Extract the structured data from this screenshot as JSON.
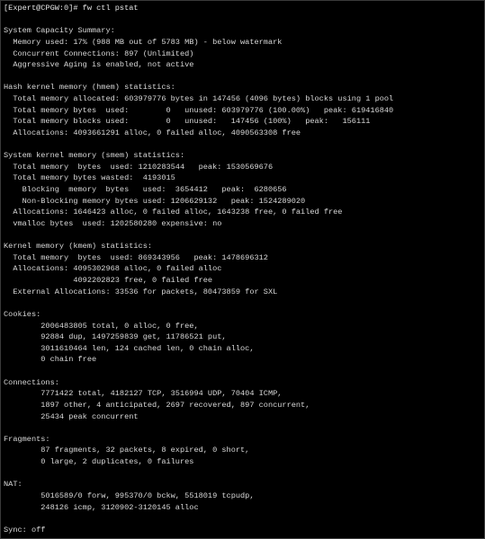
{
  "terminal": {
    "prompt": "[Expert@CPGW:0]# ",
    "command": "fw ctl pstat",
    "output_lines": [
      "",
      "System Capacity Summary:",
      "  Memory used: 17% (988 MB out of 5783 MB) - below watermark",
      "  Concurrent Connections: 897 (Unlimited)",
      "  Aggressive Aging is enabled, not active",
      "",
      "Hash kernel memory (hmem) statistics:",
      "  Total memory allocated: 603979776 bytes in 147456 (4096 bytes) blocks using 1 pool",
      "  Total memory bytes  used:        0   unused: 603979776 (100.00%)   peak: 619416840",
      "  Total memory blocks used:        0   unused:   147456 (100%)   peak:   156111",
      "  Allocations: 4093661291 alloc, 0 failed alloc, 4090563308 free",
      "",
      "System kernel memory (smem) statistics:",
      "  Total memory  bytes  used: 1210283544   peak: 1530569676",
      "  Total memory bytes wasted:  4193015",
      "    Blocking  memory  bytes   used:  3654412   peak:  6280656",
      "    Non-Blocking memory bytes used: 1206629132   peak: 1524289020",
      "  Allocations: 1646423 alloc, 0 failed alloc, 1643238 free, 0 failed free",
      "  vmalloc bytes  used: 1202580280 expensive: no",
      "",
      "Kernel memory (kmem) statistics:",
      "  Total memory  bytes  used: 869343956   peak: 1478696312",
      "  Allocations: 4095302968 alloc, 0 failed alloc",
      "               4092202823 free, 0 failed free",
      "  External Allocations: 33536 for packets, 80473859 for SXL",
      "",
      "Cookies:",
      "        2006483805 total, 0 alloc, 0 free,",
      "        92884 dup, 1497259839 get, 11786521 put,",
      "        3011610464 len, 124 cached len, 0 chain alloc,",
      "        0 chain free",
      "",
      "Connections:",
      "        7771422 total, 4182127 TCP, 3516994 UDP, 70404 ICMP,",
      "        1897 other, 4 anticipated, 2697 recovered, 897 concurrent,",
      "        25434 peak concurrent",
      "",
      "Fragments:",
      "        87 fragments, 32 packets, 8 expired, 0 short,",
      "        0 large, 2 duplicates, 0 failures",
      "",
      "NAT:",
      "        5016589/0 forw, 995370/0 bckw, 5518019 tcpudp,",
      "        248126 icmp, 3120902-3120145 alloc",
      "",
      "Sync: off"
    ]
  },
  "colors": {
    "background": "#000000",
    "text": "#d9d9d9",
    "border": "#3a3a3a"
  }
}
